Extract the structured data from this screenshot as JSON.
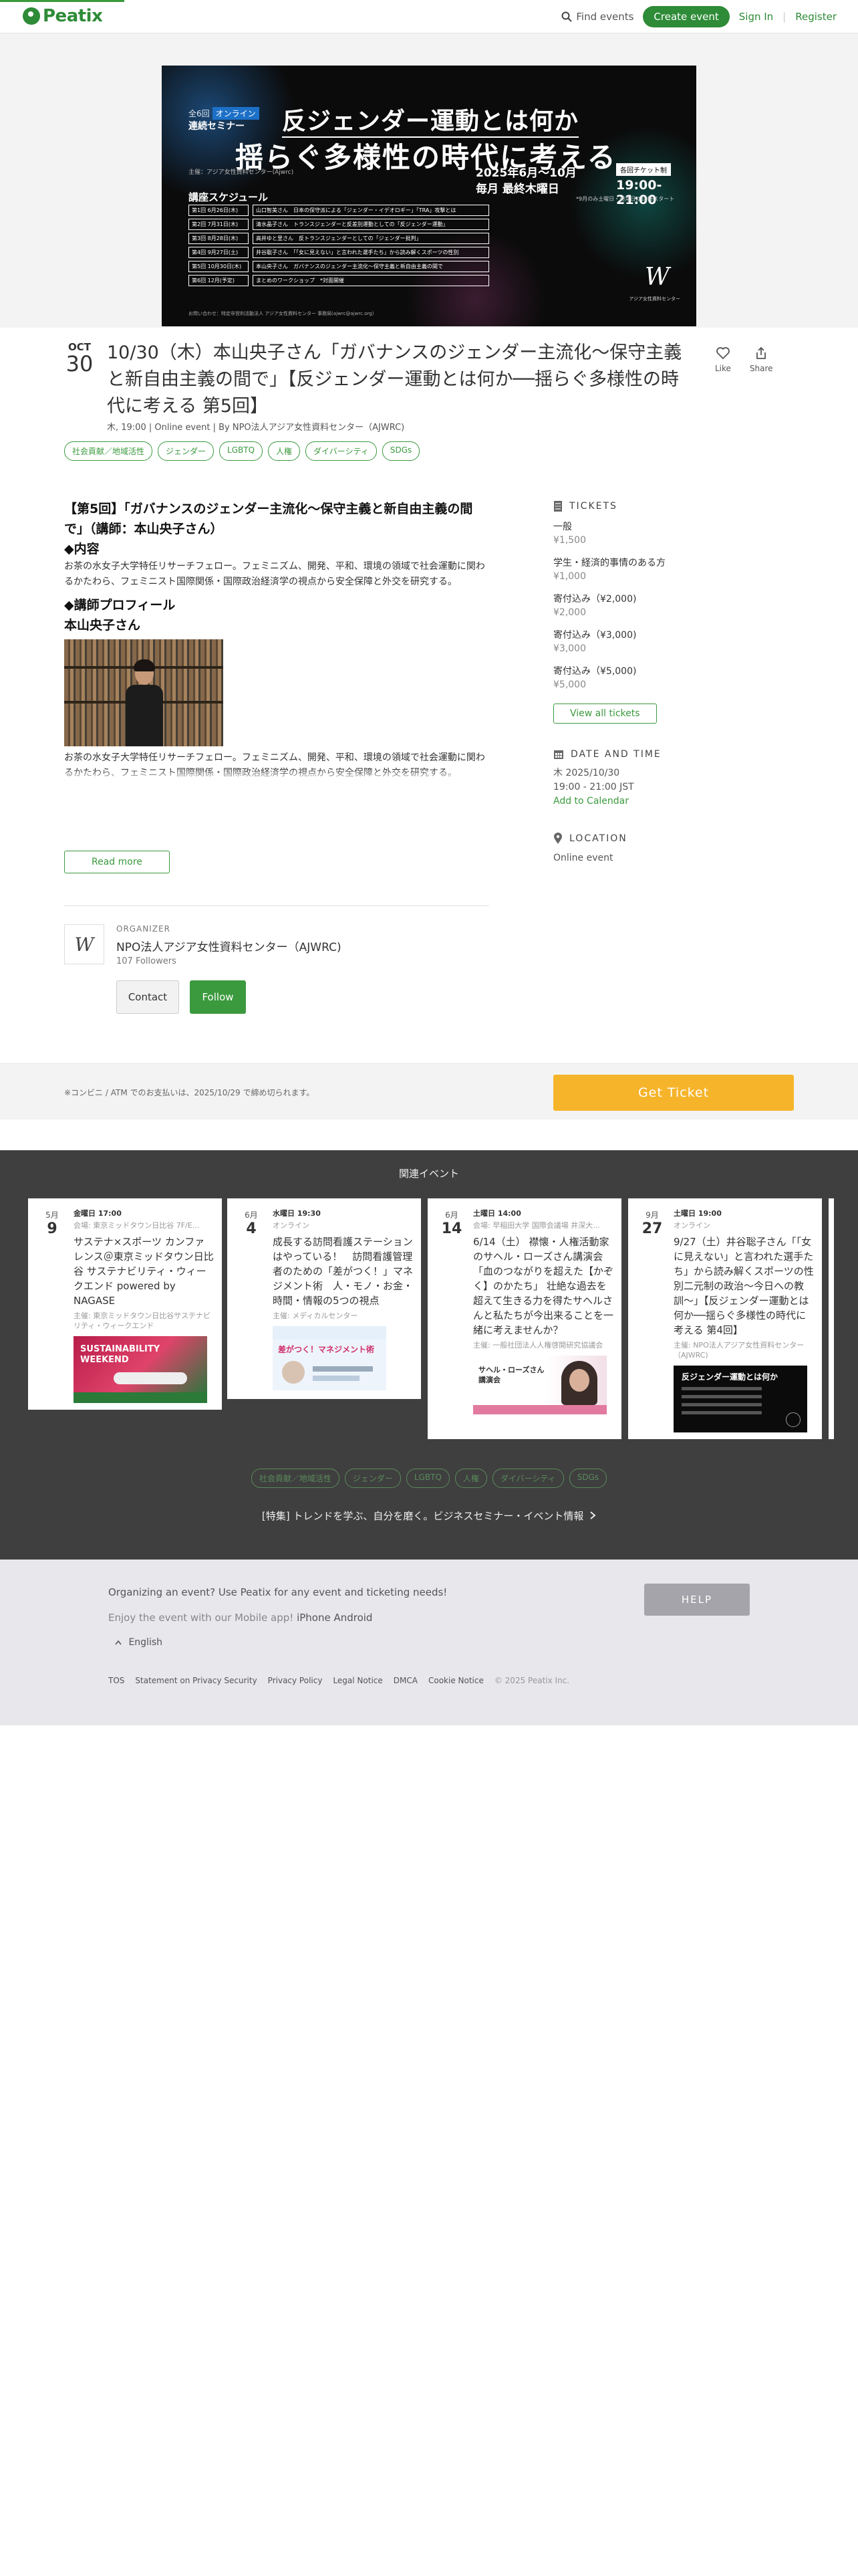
{
  "header": {
    "logo_text": "Peatix",
    "find_events": "Find events",
    "create_event": "Create event",
    "sign_in": "Sign In",
    "separator": "|",
    "register": "Register"
  },
  "banner": {
    "series_label": "全6回",
    "online_label": "オンライン",
    "series_type": "連続セミナー",
    "title_line1": "反ジェンダー運動とは何か",
    "title_line2": "揺らぐ多様性の時代に考える",
    "sponsor": "主催：アジア女性資料センター(Ajwrc)",
    "date_range": "2025年6月～10月",
    "schedule_day": "毎月 最終木曜日",
    "ticket_badge": "各回チケット制",
    "time": "19:00-21:00",
    "note": "*9月のみ土曜日・通常日は19時スタート",
    "schedule_title": "講座スケジュール",
    "rows": [
      {
        "date": "第1回 6月26日(木)",
        "session": "山口智美さん　日本の保守派による「ジェンダー・イデオロギー」「TRA」攻撃とは"
      },
      {
        "date": "第2回 7月31日(木)",
        "session": "清水晶子さん　トランスジェンダーと反差別運動としての「反ジェンダー運動」"
      },
      {
        "date": "第3回 8月28日(木)",
        "session": "高井ゆと里さん　反トランスジェンダーとしての「ジェンダー批判」"
      },
      {
        "date": "第4回 9月27日(土)",
        "session": "井谷聡子さん　「「女に見えない」と言われた選手たち」から読み解くスポーツの性別"
      },
      {
        "date": "第5回 10月30日(木)",
        "session": "本山央子さん　ガバナンスのジェンダー主流化～保守主義と新自由主義の間で"
      },
      {
        "date": "第6回 12月(予定)",
        "session": "まとめのワークショップ　*対面開催"
      }
    ],
    "footer_text": "お問い合わせ：特定非営利活動法人 アジア女性資料センター 事務局(ajwrc@ajwrc.org)",
    "logo_mark": "W",
    "logo_sub": "アジア女性資料センター"
  },
  "event": {
    "month": "OCT",
    "day": "30",
    "title": "10/30（木）本山央子さん「ガバナンスのジェンダー主流化〜保守主義と新自由主義の間で」【反ジェンダー運動とは何か──揺らぐ多様性の時代に考える 第5回】",
    "meta": "木, 19:00 | Online event | By NPO法人アジア女性資料センター（AJWRC)",
    "like": "Like",
    "share": "Share",
    "tags": [
      "社会貢献／地域活性",
      "ジェンダー",
      "LGBTQ",
      "人権",
      "ダイバーシティ",
      "SDGs"
    ]
  },
  "description": {
    "heading": "【第5回】「ガバナンスのジェンダー主流化〜保守主義と新自由主義の間で」（講師：本山央子さん）",
    "content_heading": "◆内容",
    "content_text": "お茶の水女子大学特任リサーチフェロー。フェミニズム、開発、平和、環境の領域で社会運動に関わるかたわら、フェミニスト国際関係・国際政治経済学の視点から安全保障と外交を研究する。",
    "profile_heading": "◆講師プロフィール",
    "profile_name": "本山央子さん",
    "profile_text": "お茶の水女子大学特任リサーチフェロー。フェミニズム、開発、平和、環境の領域で社会運動に関わるかたわら、フェミニスト国際関係・国際政治経済学の視点から安全保障と外交を研究する。",
    "read_more": "Read more"
  },
  "organizer": {
    "label": "ORGANIZER",
    "name": "NPO法人アジア女性資料センター（AJWRC)",
    "followers": "107 Followers",
    "contact": "Contact",
    "follow": "Follow",
    "logo_mark": "W"
  },
  "tickets": {
    "heading": "TICKETS",
    "items": [
      {
        "name": "一般",
        "price": "¥1,500"
      },
      {
        "name": "学生・経済的事情のある方",
        "price": "¥1,000"
      },
      {
        "name": "寄付込み（¥2,000)",
        "price": "¥2,000"
      },
      {
        "name": "寄付込み（¥3,000)",
        "price": "¥3,000"
      },
      {
        "name": "寄付込み（¥5,000)",
        "price": "¥5,000"
      }
    ],
    "view_all": "View all tickets"
  },
  "datetime": {
    "heading": "DATE AND TIME",
    "date": "木 2025/10/30",
    "time": "19:00 - 21:00 JST",
    "add_calendar": "Add to Calendar"
  },
  "location": {
    "heading": "LOCATION",
    "value": "Online event"
  },
  "sticky": {
    "note": "※コンビニ / ATM でのお支払いは、2025/10/29 で締め切られます。",
    "get_ticket": "Get Ticket"
  },
  "related": {
    "heading": "関連イベント",
    "cards": [
      {
        "month": "5月",
        "day": "9",
        "datetime": "金曜日 17:00",
        "location": "会場: 東京ミッドタウン日比谷 7F/E...",
        "title": "サステナ×スポーツ カンファレンス＠東京ミッドタウン日比谷 サステナビリティ・ウィークエンド powered by NAGASE",
        "host": "主催: 東京ミッドタウン日比谷サステナビリティ・ウィークエンド",
        "thumb_text": "SUSTAINABILITY WEEKEND"
      },
      {
        "month": "6月",
        "day": "4",
        "datetime": "水曜日 19:30",
        "location": "オンライン",
        "title": "成長する訪問看護ステーションはやっている！　訪問看護管理者のための「差がつく！」マネジメント術　人・モノ・お金・時間・情報の5つの視点",
        "host": "主催: メディカルセンター",
        "thumb_text": "差がつく！マネジメント術"
      },
      {
        "month": "6月",
        "day": "14",
        "datetime": "土曜日 14:00",
        "location": "会場: 早稲田大学 国際会議場 井深大...",
        "title": "6/14（土） 襟懐・人権活動家のサヘル・ローズさん講演会「血のつながりを超えた【かぞく】のかたち」 壮絶な過去を超えて生きる力を得たサヘルさんと私たちが今出来ることを一緒に考えませんか？",
        "host": "主催: 一般社団法人人権啓開研究協議会",
        "thumb_text": "サヘル・ローズさん 講演会"
      },
      {
        "month": "9月",
        "day": "27",
        "datetime": "土曜日 19:00",
        "location": "オンライン",
        "title": "9/27（土）井谷聡子さん「「女に見えない」と言われた選手たち」から読み解くスポーツの性別二元制の政治〜今日への教訓〜」【反ジェンダー運動とは何か──揺らぐ多様性の時代に考える 第4回】",
        "host": "主催: NPO法人アジア女性資料センター（AJWRC)",
        "thumb_text": "反ジェンダー運動とは何か"
      }
    ],
    "tags": [
      "社会貢献／地域活性",
      "ジェンダー",
      "LGBTQ",
      "人権",
      "ダイバーシティ",
      "SDGs"
    ],
    "feature_link": "[特集] トレンドを学ぶ、自分を磨く。ビジネスセミナー・イベント情報"
  },
  "footer": {
    "question": "Organizing an event? Use Peatix for any event and ticketing needs!",
    "app_prefix": "Enjoy the event with our Mobile app!",
    "app_links": "iPhone Android",
    "help": "HELP",
    "language": "English",
    "links": [
      "TOS",
      "Statement on Privacy Security",
      "Privacy Policy",
      "Legal Notice",
      "DMCA",
      "Cookie Notice"
    ],
    "copyright": "© 2025 Peatix Inc."
  }
}
